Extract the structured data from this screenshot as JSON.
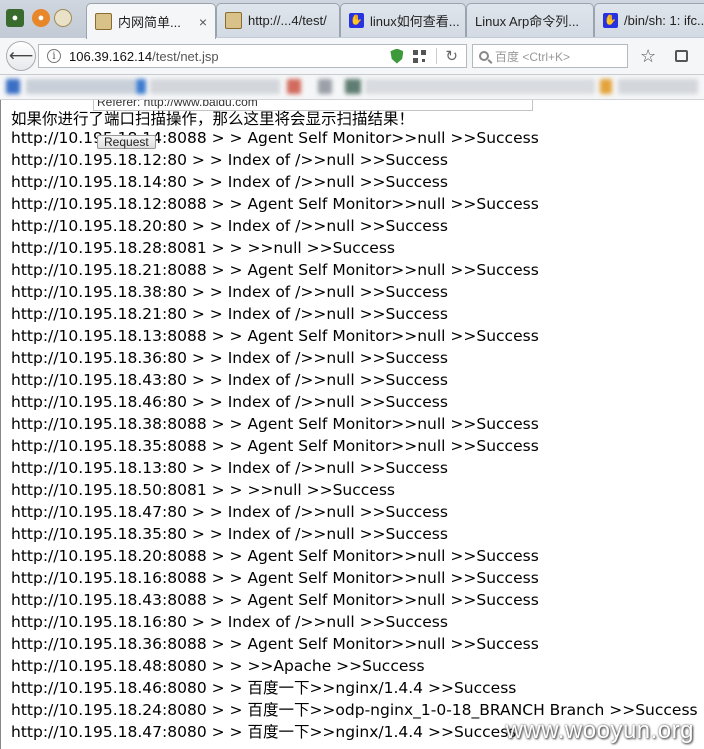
{
  "tabs": [
    {
      "title": "内网简单...",
      "favicon": "jsp-page-icon",
      "active": true
    },
    {
      "title": "http://...4/test/",
      "favicon": "jsp-page-icon",
      "active": false
    },
    {
      "title": "linux如何查看...",
      "favicon": "baidu-paw-icon",
      "active": false
    },
    {
      "title": "Linux Arp命令列...",
      "favicon": "blank-page-icon",
      "active": false
    },
    {
      "title": "/bin/sh: 1: ifc...",
      "favicon": "baidu-paw-icon",
      "active": false
    }
  ],
  "tab_close_glyph": "×",
  "navbar": {
    "url_host": "106.39.162.14",
    "url_path": "/test/net.jsp",
    "search_placeholder": "百度 <Ctrl+K>"
  },
  "form": {
    "referer_value": "Referer: http://www.baidu.com",
    "request_label": "Request"
  },
  "notice": "如果你进行了端口扫描操作，那么这里将会显示扫描结果！",
  "results": [
    "http://10.195.18.14:8088 > > Agent Self Monitor>>null >>Success",
    "http://10.195.18.12:80 > > Index of />>null >>Success",
    "http://10.195.18.14:80 > > Index of />>null >>Success",
    "http://10.195.18.12:8088 > > Agent Self Monitor>>null >>Success",
    "http://10.195.18.20:80 > > Index of />>null >>Success",
    "http://10.195.18.28:8081 > > >>null >>Success",
    "http://10.195.18.21:8088 > > Agent Self Monitor>>null >>Success",
    "http://10.195.18.38:80 > > Index of />>null >>Success",
    "http://10.195.18.21:80 > > Index of />>null >>Success",
    "http://10.195.18.13:8088 > > Agent Self Monitor>>null >>Success",
    "http://10.195.18.36:80 > > Index of />>null >>Success",
    "http://10.195.18.43:80 > > Index of />>null >>Success",
    "http://10.195.18.46:80 > > Index of />>null >>Success",
    "http://10.195.18.38:8088 > > Agent Self Monitor>>null >>Success",
    "http://10.195.18.35:8088 > > Agent Self Monitor>>null >>Success",
    "http://10.195.18.13:80 > > Index of />>null >>Success",
    "http://10.195.18.50:8081 > > >>null >>Success",
    "http://10.195.18.47:80 > > Index of />>null >>Success",
    "http://10.195.18.35:80 > > Index of />>null >>Success",
    "http://10.195.18.20:8088 > > Agent Self Monitor>>null >>Success",
    "http://10.195.18.16:8088 > > Agent Self Monitor>>null >>Success",
    "http://10.195.18.43:8088 > > Agent Self Monitor>>null >>Success",
    "http://10.195.18.16:80 > > Index of />>null >>Success",
    "http://10.195.18.36:8088 > > Agent Self Monitor>>null >>Success",
    "http://10.195.18.48:8080 > > >>Apache >>Success",
    "http://10.195.18.46:8080 > > 百度一下>>nginx/1.4.4 >>Success",
    "http://10.195.18.24:8080 > > 百度一下>>odp-nginx_1-0-18_BRANCH Branch >>Success",
    "http://10.195.18.47:8080 > > 百度一下>>nginx/1.4.4 >>Success"
  ],
  "watermark": "www.wooyun.org",
  "colors": {
    "secure_shield": "#3d9a3b",
    "baidu_blue": "#2932e1",
    "chrome_bg": "#f5f6f7"
  }
}
